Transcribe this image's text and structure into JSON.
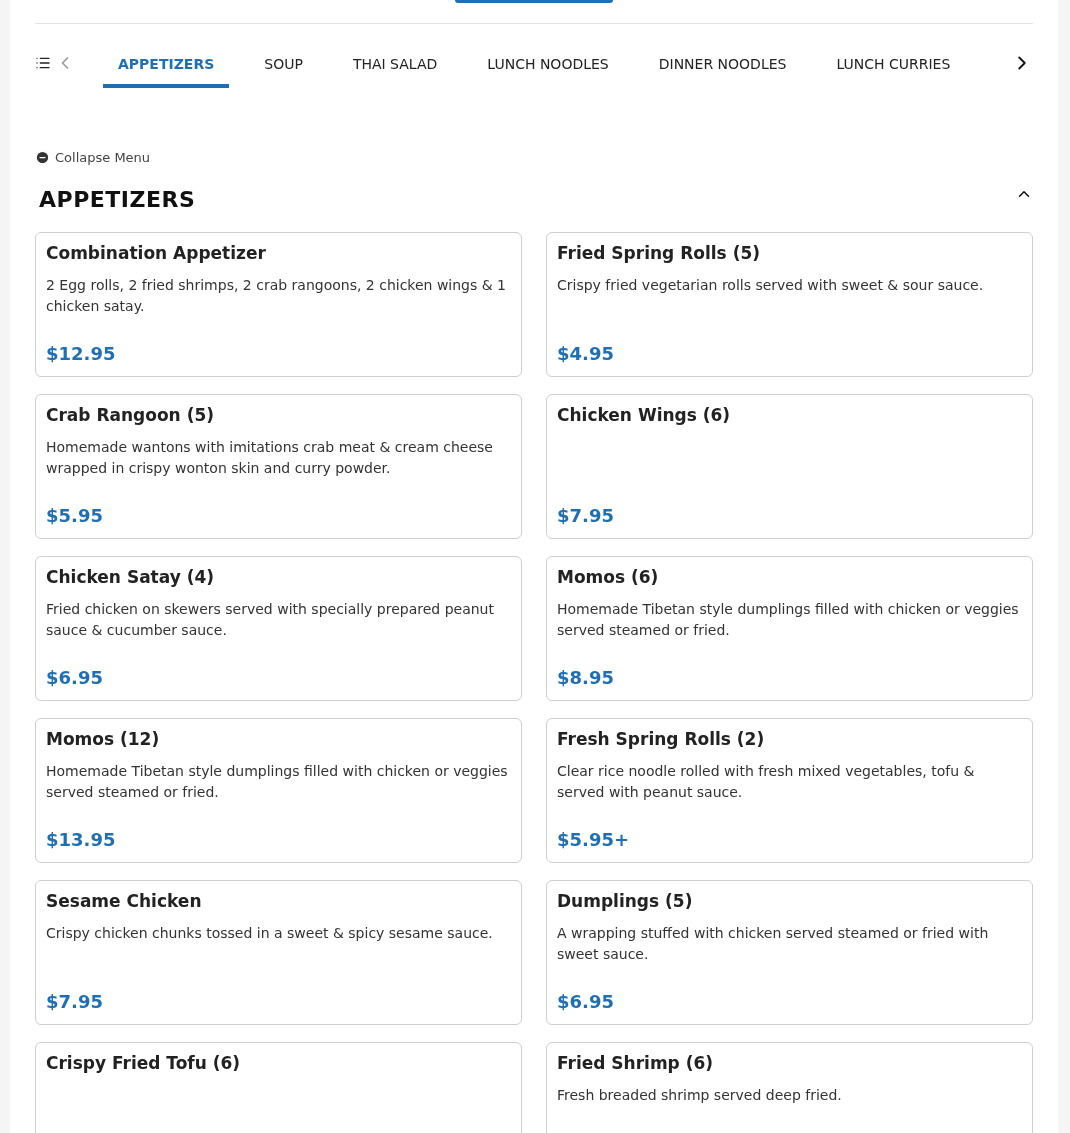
{
  "tabs": [
    {
      "label": "APPETIZERS",
      "selected": true
    },
    {
      "label": "SOUP",
      "selected": false
    },
    {
      "label": "THAI SALAD",
      "selected": false
    },
    {
      "label": "LUNCH NOODLES",
      "selected": false
    },
    {
      "label": "DINNER NOODLES",
      "selected": false
    },
    {
      "label": "LUNCH CURRIES",
      "selected": false
    }
  ],
  "collapse_label": "Collapse Menu",
  "section": {
    "title": "APPETIZERS",
    "expanded": true
  },
  "items": [
    {
      "name": "Combination Appetizer",
      "description": "2 Egg rolls, 2 fried shrimps, 2 crab rangoons, 2 chicken wings & 1 chicken satay.",
      "price": "$12.95"
    },
    {
      "name": "Fried Spring Rolls (5)",
      "description": "Crispy fried vegetarian rolls served with sweet & sour sauce.",
      "price": "$4.95"
    },
    {
      "name": "Crab Rangoon (5)",
      "description": "Homemade wantons with imitations crab meat & cream cheese wrapped in crispy wonton skin and curry powder.",
      "price": "$5.95"
    },
    {
      "name": "Chicken Wings (6)",
      "price": "$7.95"
    },
    {
      "name": "Chicken Satay (4)",
      "description": "Fried chicken on skewers served with specially prepared peanut sauce & cucumber sauce.",
      "price": "$6.95"
    },
    {
      "name": "Momos (6)",
      "description": "Homemade Tibetan style dumplings filled with chicken or veggies served steamed or fried.",
      "price": "$8.95"
    },
    {
      "name": "Momos (12)",
      "description": "Homemade Tibetan style dumplings filled with chicken or veggies served steamed or fried.",
      "price": "$13.95"
    },
    {
      "name": "Fresh Spring Rolls (2)",
      "description": "Clear rice noodle rolled with fresh mixed vegetables, tofu & served with peanut sauce.",
      "price": "$5.95+"
    },
    {
      "name": "Sesame Chicken",
      "description": "Crispy chicken chunks tossed in a sweet & spicy sesame sauce.",
      "price": "$7.95"
    },
    {
      "name": "Dumplings (5)",
      "description": "A wrapping stuffed with chicken served steamed or fried with sweet sauce.",
      "price": "$6.95"
    },
    {
      "name": "Crispy Fried Tofu (6)"
    },
    {
      "name": "Fried Shrimp (6)",
      "description": "Fresh breaded shrimp served deep fried."
    }
  ]
}
